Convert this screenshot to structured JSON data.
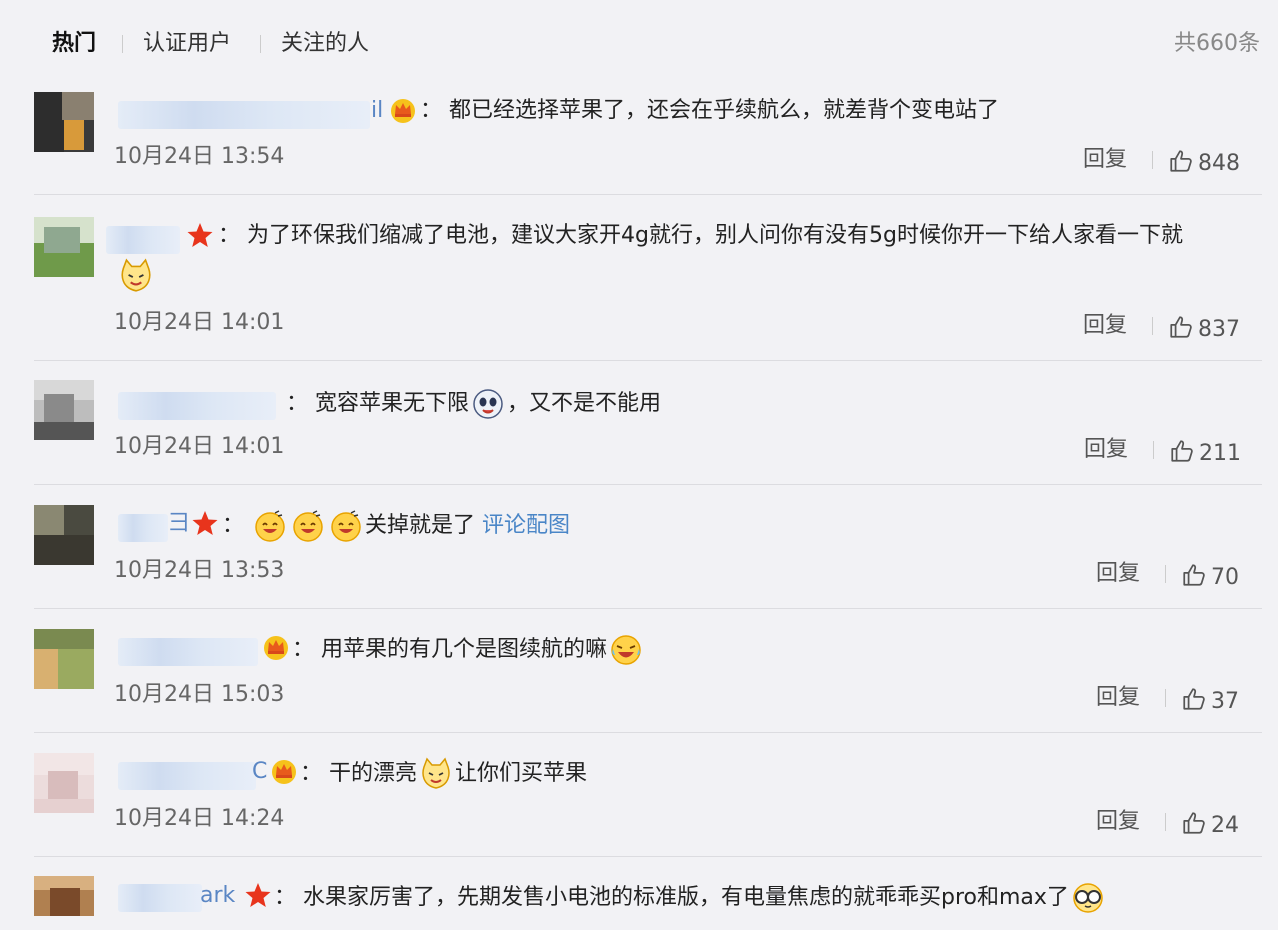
{
  "tabs": {
    "hot": "热门",
    "verified": "认证用户",
    "following": "关注的人"
  },
  "total_count": "共660条",
  "colors": {
    "link": "#4a86c7",
    "crown": "#f0a800",
    "star": "#e8341c"
  },
  "comments": [
    {
      "name_tail": "il",
      "badge": "crown-icon",
      "text": "都已经选择苹果了，还会在乎续航么，就差背个变电站了",
      "time": "10月24日 13:54",
      "reply": "回复",
      "likes": "848"
    },
    {
      "name_tail": "",
      "badge": "star-icon",
      "text": "为了环保我们缩减了电池，建议大家开4g就行，别人问你有没有5g时候你开一下给人家看一下就",
      "time": "10月24日 14:01",
      "reply": "回复",
      "likes": "837"
    },
    {
      "name_tail": "",
      "badge": "",
      "text_a": "宽容苹果无下限",
      "text_b": "，又不是不能用",
      "time": "10月24日 14:01",
      "reply": "回复",
      "likes": "211"
    },
    {
      "name_tail": "",
      "badge": "star-icon",
      "text": "关掉就是了",
      "link": "评论配图",
      "time": "10月24日 13:53",
      "reply": "回复",
      "likes": "70"
    },
    {
      "name_tail": "",
      "badge": "crown-icon",
      "text": "用苹果的有几个是图续航的嘛",
      "time": "10月24日 15:03",
      "reply": "回复",
      "likes": "37"
    },
    {
      "name_tail": "",
      "badge": "crown-icon",
      "text_a": "干的漂亮",
      "text_b": "让你们买苹果",
      "time": "10月24日 14:24",
      "reply": "回复",
      "likes": "24"
    },
    {
      "name_tail": "ark",
      "badge": "star-icon",
      "text": "水果家厉害了，先期发售小电池的标准版，有电量焦虑的就乖乖买pro和max了"
    }
  ],
  "colon": "："
}
